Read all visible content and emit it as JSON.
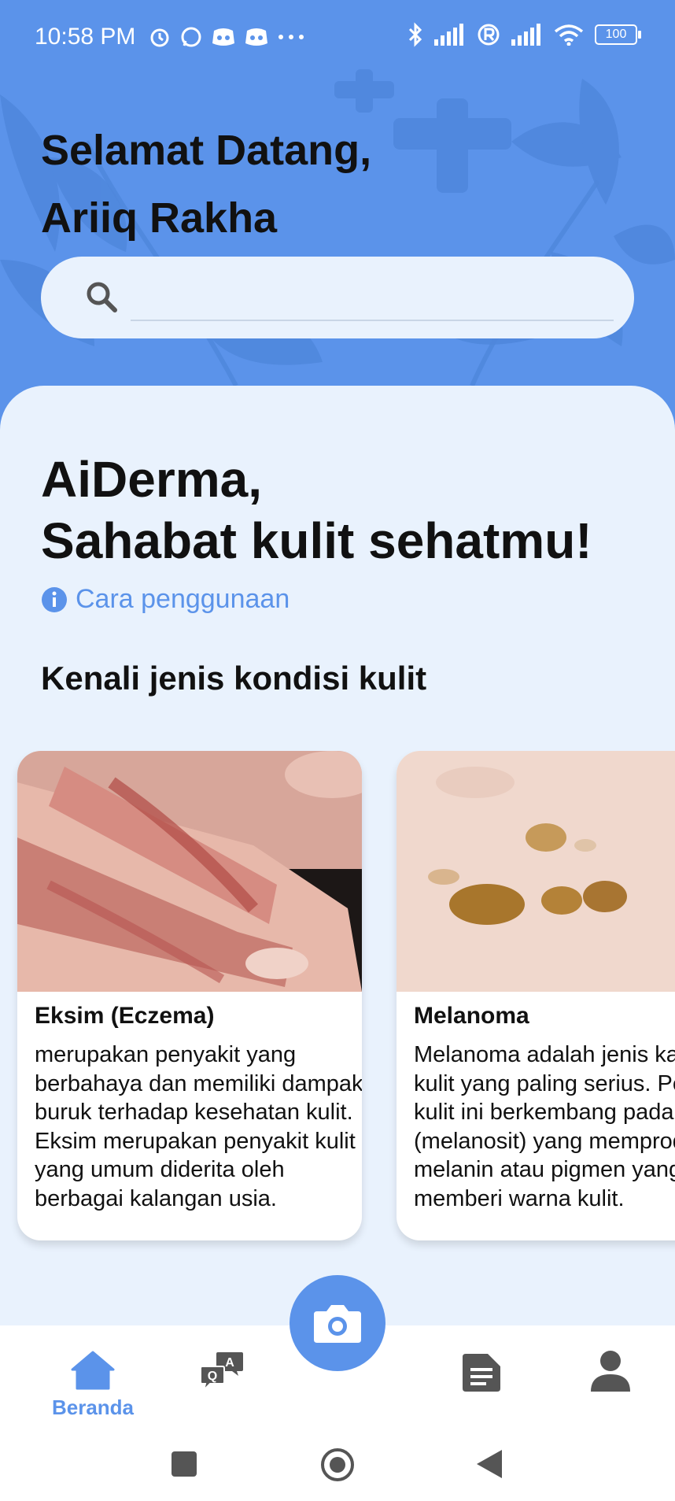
{
  "status_bar": {
    "time": "10:58 PM",
    "battery": "100"
  },
  "header": {
    "greeting": "Selamat Datang,",
    "username": "Ariiq Rakha",
    "search_placeholder": ""
  },
  "main": {
    "hero_line1": "AiDerma,",
    "hero_line2": "Sahabat kulit sehatmu!",
    "howto_link": "Cara penggunaan",
    "section_title": "Kenali jenis kondisi kulit",
    "cards": [
      {
        "title": "Eksim (Eczema)",
        "text": "merupakan penyakit yang berbahaya dan memiliki dampak buruk terhadap kesehatan kulit. Eksim merupakan penyakit kulit yang umum diderita oleh berbagai kalangan usia."
      },
      {
        "title": "Melanoma",
        "text": "Melanoma adalah jenis kanker kulit yang paling serius. Penyakit kulit ini berkembang pada sel (melanosit) yang memproduksi melanin atau pigmen yang memberi warna kulit."
      }
    ]
  },
  "bottom_nav": {
    "home_label": "Beranda"
  },
  "colors": {
    "accent": "#5b93ea",
    "panel": "#e9f2fd"
  }
}
